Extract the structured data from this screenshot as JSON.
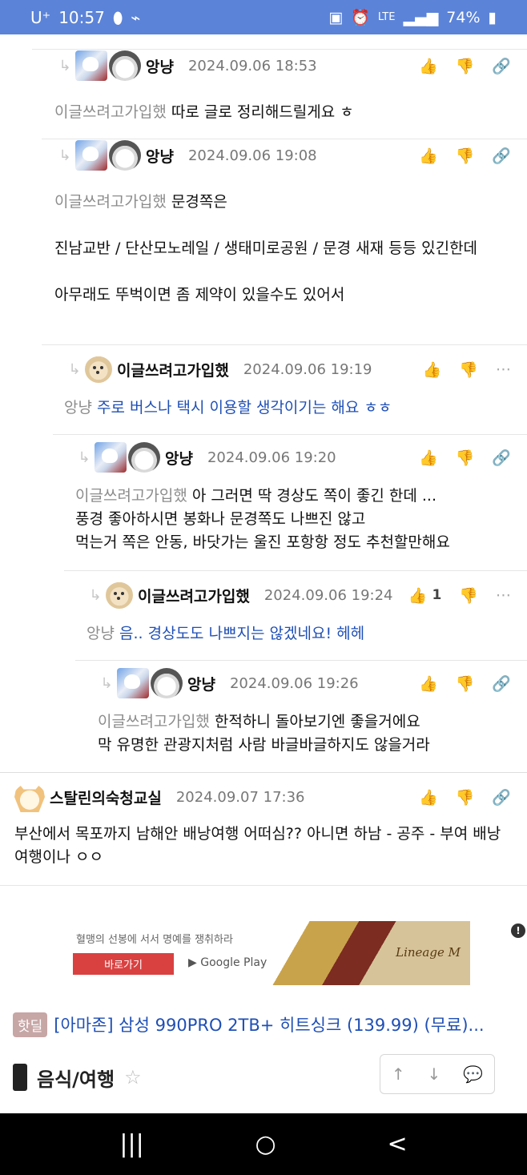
{
  "status": {
    "carrier": "U⁺",
    "time": "10:57",
    "network": "LTE",
    "battery": "74%"
  },
  "icons": {
    "reply": "reply-arrow-icon",
    "like": "thumbs-up-icon",
    "dislike": "thumbs-down-icon",
    "link": "link-icon",
    "more": "more-icon"
  },
  "comments": [
    {
      "nick": "앙냥",
      "date": "2024.09.06 18:53",
      "mention": "이글쓰려고가입했",
      "text": " 따로 글로 정리해드릴게요 ㅎ",
      "likes": ""
    },
    {
      "nick": "앙냥",
      "date": "2024.09.06 19:08",
      "mention": "이글쓰려고가입했",
      "text": " 문경쪽은\n\n진남교반 / 단산모노레일 / 생태미로공원 / 문경 새재 등등 있긴한데\n\n아무래도 뚜벅이면 좀 제약이 있을수도 있어서",
      "likes": ""
    },
    {
      "nick": "이글쓰려고가입했",
      "date": "2024.09.06 19:19",
      "mention": "앙냥",
      "text": " 주로 버스나 택시 이용할 생각이기는 해요 ㅎㅎ",
      "likes": ""
    },
    {
      "nick": "앙냥",
      "date": "2024.09.06 19:20",
      "mention": "이글쓰려고가입했",
      "text": " 아 그러면 딱 경상도 쪽이 좋긴 한데 ...\n풍경 좋아하시면 봉화나 문경쪽도 나쁘진 않고\n먹는거 쪽은 안동, 바닷가는 울진 포항항 정도 추천할만해요",
      "likes": ""
    },
    {
      "nick": "이글쓰려고가입했",
      "date": "2024.09.06 19:24",
      "mention": "앙냥",
      "text": " 음.. 경상도도 나쁘지는 않겠네요! 헤헤",
      "likes": "1"
    },
    {
      "nick": "앙냥",
      "date": "2024.09.06 19:26",
      "mention": "이글쓰려고가입했",
      "text": " 한적하니 돌아보기엔 좋을거에요\n막 유명한 관광지처럼 사람 바글바글하지도 않을거라",
      "likes": ""
    },
    {
      "nick": "스탈린의숙청교실",
      "date": "2024.09.07 17:36",
      "mention": "",
      "text": "부산에서 목포까지 남해안 배낭여행 어떠심?? 아니면 하남 - 공주 - 부여 배낭여행이나 ㅇㅇ",
      "likes": ""
    }
  ],
  "ad": {
    "text": "혈맹의 선봉에 서서 명예를 쟁취하라",
    "button": "바로가기",
    "store": "Google Play",
    "logo": "Lineage M"
  },
  "hotdeal": {
    "badge": "핫딜",
    "title": "[아마존] 삼성 990PRO 2TB+ 히트싱크 (139.99) (무료)..."
  },
  "board": {
    "title": "음식/여행"
  },
  "system_nav": {
    "recent": "|||",
    "home": "○",
    "back": "<"
  }
}
